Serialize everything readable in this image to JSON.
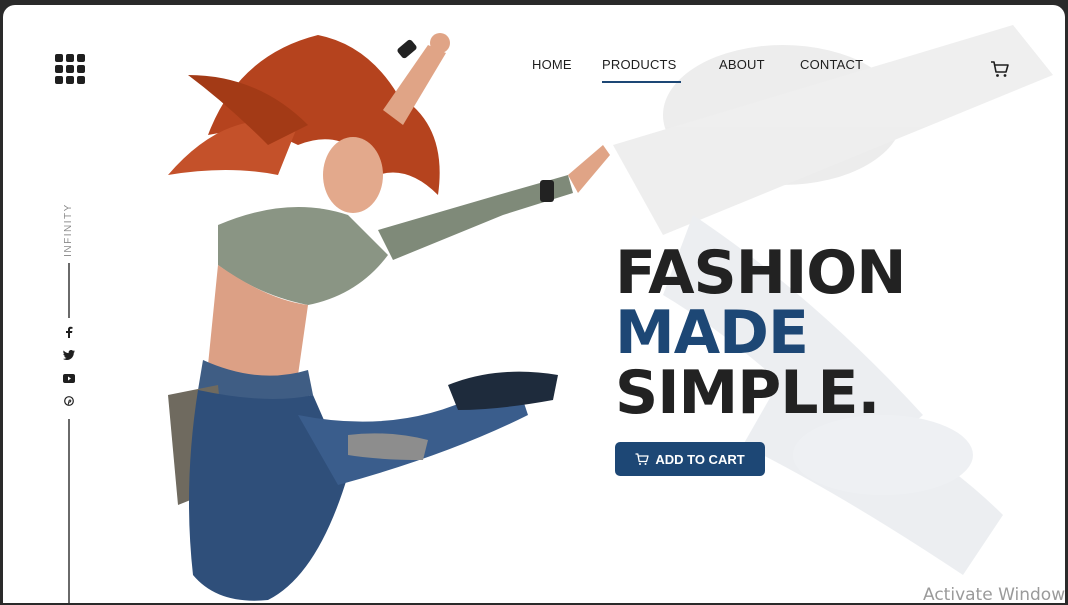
{
  "brand": {
    "vertical_label": "INFINITY"
  },
  "nav": {
    "items": [
      {
        "label": "HOME",
        "active": false
      },
      {
        "label": "PRODUCTS",
        "active": true
      },
      {
        "label": "ABOUT",
        "active": false
      },
      {
        "label": "CONTACT",
        "active": false
      }
    ]
  },
  "social": [
    "facebook-icon",
    "twitter-icon",
    "youtube-icon",
    "pinterest-icon"
  ],
  "hero": {
    "line1": "FASHION",
    "line2": "MADE",
    "line3": "SIMPLE.",
    "cta_label": "ADD TO CART"
  },
  "colors": {
    "accent": "#1d4775",
    "text": "#222222"
  },
  "system": {
    "watermark": "Activate Window"
  }
}
